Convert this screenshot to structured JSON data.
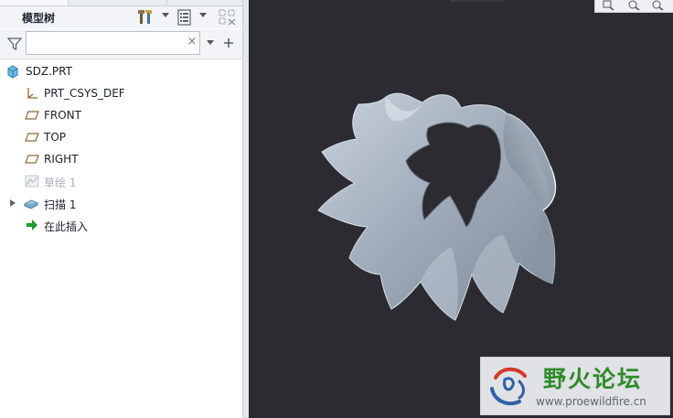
{
  "model_tree": {
    "title": "模型树",
    "search": {
      "value": "",
      "clear_glyph": "×"
    },
    "items": [
      {
        "label": "SDZ.PRT",
        "icon": "part-icon",
        "state": "normal"
      },
      {
        "label": "PRT_CSYS_DEF",
        "icon": "csys-icon",
        "state": "normal"
      },
      {
        "label": "FRONT",
        "icon": "datum-plane-icon",
        "state": "normal"
      },
      {
        "label": "TOP",
        "icon": "datum-plane-icon",
        "state": "normal"
      },
      {
        "label": "RIGHT",
        "icon": "datum-plane-icon",
        "state": "normal"
      },
      {
        "label": "草绘 1",
        "icon": "sketch-icon",
        "state": "hidden"
      },
      {
        "label": "扫描 1",
        "icon": "sweep-icon",
        "state": "normal",
        "expandable": true
      },
      {
        "label": "在此插入",
        "icon": "insert-arrow-icon",
        "state": "normal"
      }
    ]
  },
  "watermark": {
    "title": "野火论坛",
    "url": "www.proewildfire.cn"
  },
  "colors": {
    "viewport_bg": "#2b2b31",
    "model_surface": "#9eaab8",
    "watermark_green": "#2f8a2b",
    "insert_arrow": "#1f9a2f"
  }
}
